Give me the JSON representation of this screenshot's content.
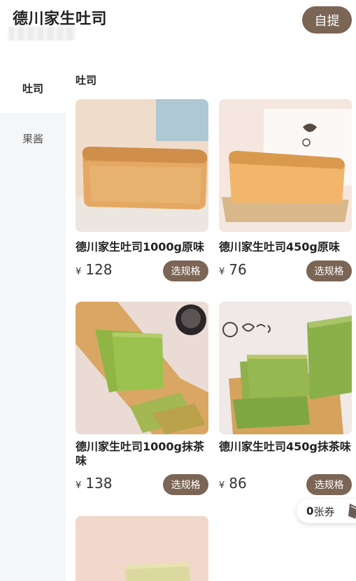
{
  "header": {
    "store_name": "德川家生吐司",
    "pickup_label": "自提"
  },
  "sidebar": {
    "items": [
      {
        "label": "吐司",
        "active": true
      },
      {
        "label": "果酱",
        "active": false
      }
    ]
  },
  "main": {
    "section_title": "吐司",
    "currency_symbol": "¥",
    "spec_label": "选规格",
    "products": [
      {
        "name": "德川家生吐司1000g原味",
        "price": "128"
      },
      {
        "name": "德川家生吐司450g原味",
        "price": "76"
      },
      {
        "name": "德川家生吐司1000g抹茶味",
        "price": "138"
      },
      {
        "name": "德川家生吐司450g抹茶味",
        "price": "86"
      }
    ]
  },
  "coupon": {
    "count": "0",
    "label": "张券"
  },
  "colors": {
    "accent": "#7b6555",
    "sidebar_bg": "#f5f6f8"
  }
}
